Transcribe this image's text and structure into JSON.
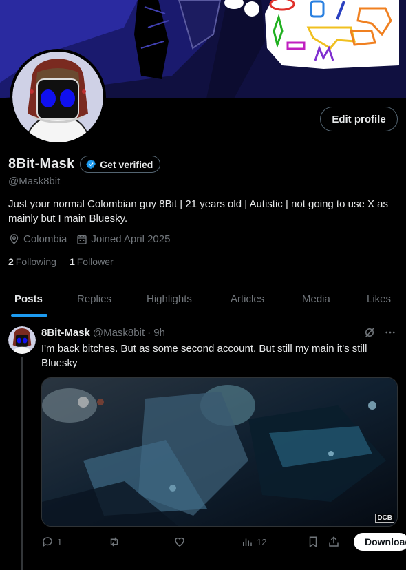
{
  "profile": {
    "display_name": "8Bit-Mask",
    "verify_label": "Get verified",
    "handle": "@Mask8bit",
    "bio": "Just your normal Colombian guy 8Bit | 21 years old | Autistic | not going to use X as mainly but I main Bluesky.",
    "location": "Colombia",
    "joined": "Joined April 2025",
    "following_count": "2",
    "following_label": "Following",
    "followers_count": "1",
    "followers_label": "Follower",
    "edit_label": "Edit profile"
  },
  "tabs": [
    {
      "label": "Posts",
      "active": true
    },
    {
      "label": "Replies"
    },
    {
      "label": "Highlights"
    },
    {
      "label": "Articles"
    },
    {
      "label": "Media"
    },
    {
      "label": "Likes"
    }
  ],
  "post": {
    "author": "8Bit-Mask",
    "handle": "@Mask8bit",
    "time": "· 9h",
    "text": "I'm back bitches. But as some second account. But still my main it's still Bluesky",
    "media_badge": "DCB",
    "replies": "1",
    "views": "12",
    "download_label": "Download"
  },
  "colors": {
    "accent": "#1d9bf0",
    "text": "#e7e9ea",
    "muted": "#71767b",
    "border": "#2f3336"
  },
  "icons": {
    "location": "location-pin-icon",
    "calendar": "calendar-icon",
    "verified": "verified-badge-icon",
    "grok": "grok-icon",
    "more": "more-icon",
    "reply": "reply-icon",
    "repost": "repost-icon",
    "like": "heart-icon",
    "views": "views-icon",
    "bookmark": "bookmark-icon",
    "share": "share-icon",
    "download": "download-icon"
  }
}
